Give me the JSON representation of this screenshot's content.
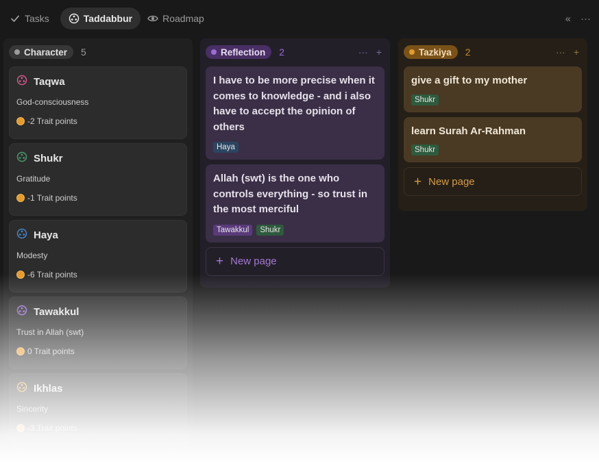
{
  "tabs": [
    {
      "label": "Tasks",
      "icon": "check-icon"
    },
    {
      "label": "Taddabbur",
      "icon": "taddabbur-icon"
    },
    {
      "label": "Roadmap",
      "icon": "eye-icon"
    }
  ],
  "toolbar": {
    "collapse_icon": "«",
    "more_icon": "···"
  },
  "columns": {
    "character": {
      "label": "Character",
      "count": "5",
      "cards": [
        {
          "title": "Taqwa",
          "subtitle": "God-consciousness",
          "points": "-2 Trait points",
          "icon_color": "#d05c8b"
        },
        {
          "title": "Shukr",
          "subtitle": "Gratitude",
          "points": "-1 Trait points",
          "icon_color": "#4a9c6b"
        },
        {
          "title": "Haya",
          "subtitle": "Modesty",
          "points": "-6 Trait points",
          "icon_color": "#4a86c9"
        },
        {
          "title": "Tawakkul",
          "subtitle": "Trust in Allah (swt)",
          "points": "0 Trait points",
          "icon_color": "#9a6dd7"
        },
        {
          "title": "Ikhlas",
          "subtitle": "Sincerity",
          "points": "-3 Trait points",
          "icon_color": "#e39b2e"
        }
      ]
    },
    "reflection": {
      "label": "Reflection",
      "count": "2",
      "cards": [
        {
          "title": "I have to be more precise when it comes to knowledge - and i also have to accept the opinion of others",
          "tags": [
            {
              "label": "Haya",
              "color": "blue"
            }
          ]
        },
        {
          "title": "Allah (swt) is the one who controls everything - so trust in the most merciful",
          "tags": [
            {
              "label": "Tawakkul",
              "color": "purple"
            },
            {
              "label": "Shukr",
              "color": "green"
            }
          ]
        }
      ],
      "new_page": "New page"
    },
    "tazkiya": {
      "label": "Tazkiya",
      "count": "2",
      "cards": [
        {
          "title": "give a gift to my mother",
          "tags": [
            {
              "label": "Shukr",
              "color": "green"
            }
          ]
        },
        {
          "title": "learn Surah Ar-Rahman",
          "tags": [
            {
              "label": "Shukr",
              "color": "green"
            }
          ]
        }
      ],
      "new_page": "New page"
    }
  }
}
